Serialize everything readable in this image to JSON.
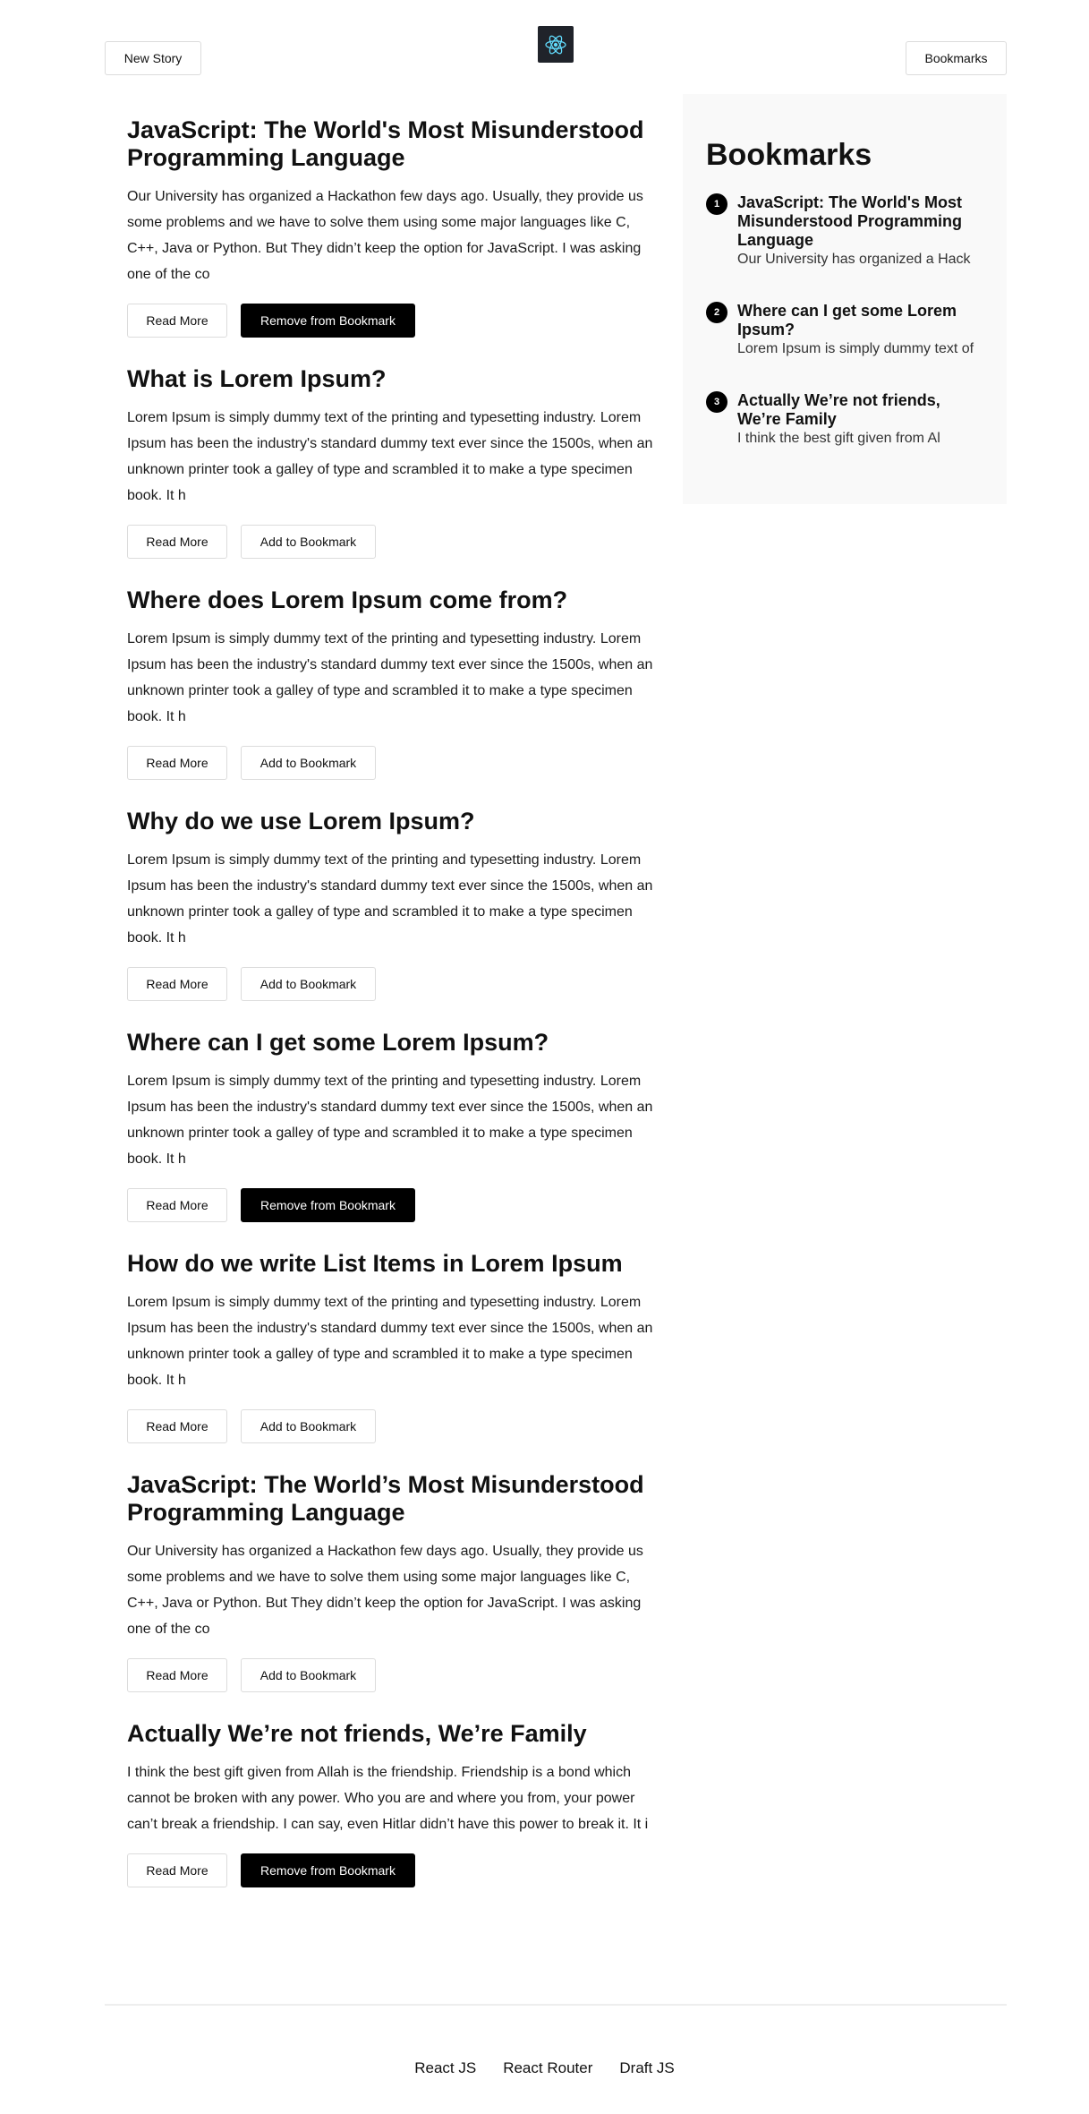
{
  "header": {
    "new_story_label": "New Story",
    "bookmarks_label": "Bookmarks",
    "logo_icon": "react-atom-icon",
    "logo_color": "#61dafb",
    "logo_bg": "#20232a"
  },
  "articles": [
    {
      "title": "JavaScript: The World's Most Misunderstood Programming Language",
      "excerpt": "Our University has organized a Hackathon few days ago. Usually, they provide us some problems and we have to solve them using some major languages like C, C++, Java or Python. But They didn’t keep the option for JavaScript. I was asking one of the co",
      "read_more": "Read More",
      "bookmark_label": "Remove from Bookmark",
      "bookmarked": true
    },
    {
      "title": "What is Lorem Ipsum?",
      "excerpt": "Lorem Ipsum is simply dummy text of the printing and typesetting industry. Lorem Ipsum has been the industry's standard dummy text ever since the 1500s, when an unknown printer took a galley of type and scrambled it to make a type specimen book. It h",
      "read_more": "Read More",
      "bookmark_label": "Add to Bookmark",
      "bookmarked": false
    },
    {
      "title": "Where does Lorem Ipsum come from?",
      "excerpt": "Lorem Ipsum is simply dummy text of the printing and typesetting industry. Lorem Ipsum has been the industry's standard dummy text ever since the 1500s, when an unknown printer took a galley of type and scrambled it to make a type specimen book. It h",
      "read_more": "Read More",
      "bookmark_label": "Add to Bookmark",
      "bookmarked": false
    },
    {
      "title": "Why do we use Lorem Ipsum?",
      "excerpt": "Lorem Ipsum is simply dummy text of the printing and typesetting industry. Lorem Ipsum has been the industry's standard dummy text ever since the 1500s, when an unknown printer took a galley of type and scrambled it to make a type specimen book. It h",
      "read_more": "Read More",
      "bookmark_label": "Add to Bookmark",
      "bookmarked": false
    },
    {
      "title": "Where can I get some Lorem Ipsum?",
      "excerpt": "Lorem Ipsum is simply dummy text of the printing and typesetting industry. Lorem Ipsum has been the industry's standard dummy text ever since the 1500s, when an unknown printer took a galley of type and scrambled it to make a type specimen book. It h",
      "read_more": "Read More",
      "bookmark_label": "Remove from Bookmark",
      "bookmarked": true
    },
    {
      "title": "How do we write List Items in Lorem Ipsum",
      "excerpt": "Lorem Ipsum is simply dummy text of the printing and typesetting industry. Lorem Ipsum has been the industry's standard dummy text ever since the 1500s, when an unknown printer took a galley of type and scrambled it to make a type specimen book. It h",
      "read_more": "Read More",
      "bookmark_label": "Add to Bookmark",
      "bookmarked": false
    },
    {
      "title": "JavaScript: The World’s Most Misunderstood Programming Language",
      "excerpt": "Our University has organized a Hackathon few days ago. Usually, they provide us some problems and we have to solve them using some major languages like C, C++, Java or Python. But They didn’t keep the option for JavaScript. I was asking one of the co",
      "read_more": "Read More",
      "bookmark_label": "Add to Bookmark",
      "bookmarked": false
    },
    {
      "title": "Actually We’re not friends, We’re Family",
      "excerpt": "I think the best gift given from Allah is the friendship. Friendship is a bond which cannot be broken with any power. Who you are and where you from, your power can’t break a friendship. I can say, even Hitlar didn’t have this power to break it. It i",
      "read_more": "Read More",
      "bookmark_label": "Remove from Bookmark",
      "bookmarked": true
    }
  ],
  "bookmarks_panel": {
    "heading": "Bookmarks",
    "items": [
      {
        "number": "1",
        "title": "JavaScript: The World's Most Misunderstood Programming Language",
        "excerpt": "Our University has organized a Hack"
      },
      {
        "number": "2",
        "title": "Where can I get some Lorem Ipsum?",
        "excerpt": "Lorem Ipsum is simply dummy text of"
      },
      {
        "number": "3",
        "title": "Actually We’re not friends, We’re Family",
        "excerpt": "I think the best gift given from Al"
      }
    ]
  },
  "footer": {
    "links": [
      "React JS",
      "React Router",
      "Draft JS"
    ]
  }
}
